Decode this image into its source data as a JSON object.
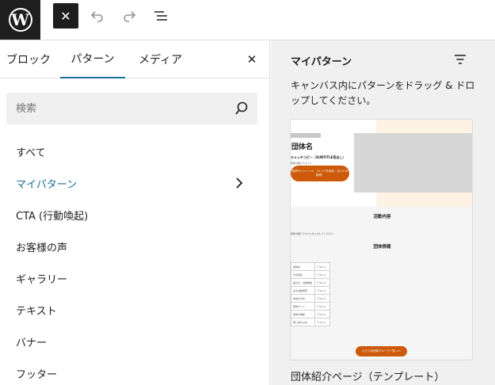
{
  "toolbar": {
    "logo": "W",
    "close_glyph": "✕",
    "icons": [
      "wordpress-logo",
      "close-icon",
      "undo-icon",
      "redo-icon",
      "list-view-icon"
    ]
  },
  "inserter": {
    "tabs": [
      {
        "label": "ブロック"
      },
      {
        "label": "パターン"
      },
      {
        "label": "メディア"
      }
    ],
    "active_tab": "パターン",
    "close_glyph": "✕",
    "search": {
      "placeholder": "検索",
      "value": ""
    },
    "categories": [
      {
        "label": "すべて"
      },
      {
        "label": "マイパターン"
      },
      {
        "label": "CTA (行動喚起)"
      },
      {
        "label": "お客様の声"
      },
      {
        "label": "ギャラリー"
      },
      {
        "label": "テキスト"
      },
      {
        "label": "バナー"
      },
      {
        "label": "フッター"
      }
    ],
    "selected_category": "マイパターン"
  },
  "patterns_panel": {
    "title": "マイパターン",
    "description": "キャンバス内にパターンをドラッグ & ドロップしてください。",
    "preview": {
      "title": "団体名",
      "catchcopy": "キャッチコピー（SUBTITLE見出し）",
      "sub": "団体の紹介テキスト",
      "button1": "団体サイトへ >> （リンクを設定・ないCTA説明）",
      "section1": "活動内容",
      "small_text": "団体の紹介テキストを入力してください",
      "section2": "団体情報",
      "table": [
        [
          "団体名",
          "テキスト"
        ],
        [
          "代表者名",
          "テキスト"
        ],
        [
          "設立日・活動開始",
          "テキスト"
        ],
        [
          "主な活動場所",
          "テキスト"
        ],
        [
          "参加の方法",
          "テキスト"
        ],
        [
          "団体サイト",
          "テキスト"
        ],
        [
          "団体の規模",
          "テキスト"
        ],
        [
          "問い合わせ先",
          "テキスト"
        ]
      ],
      "button2": "ひろりあ団体グループ一覧 >>"
    },
    "caption": "団体紹介ページ（テンプレート）"
  },
  "colors": {
    "accent": "#1b6e99",
    "dark": "#1e1e1e",
    "panel_bg": "#f0f0f0",
    "brand_orange": "#cc5a0a",
    "peach": "#fdf2e4"
  }
}
